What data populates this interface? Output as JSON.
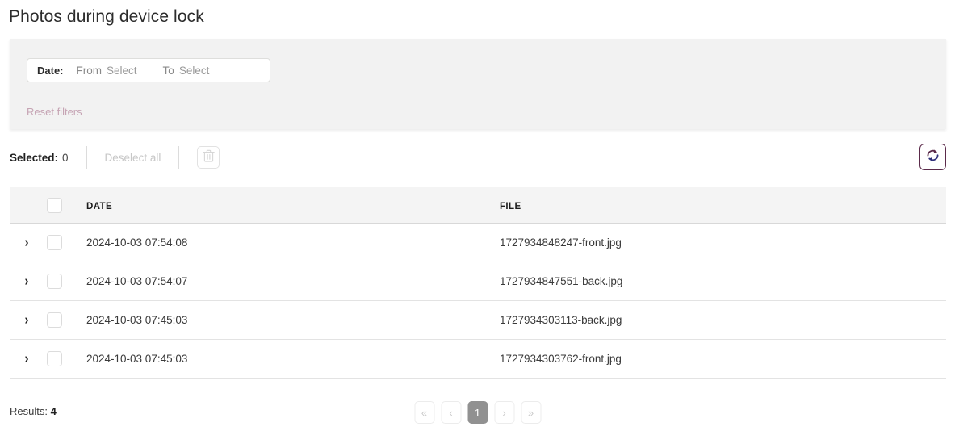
{
  "header": {
    "title": "Photos during device lock"
  },
  "filters": {
    "date": {
      "label": "Date:",
      "from_prefix": "From",
      "from_value": "Select",
      "to_prefix": "To",
      "to_value": "Select"
    },
    "reset_label": "Reset filters"
  },
  "toolbar": {
    "selected_label": "Selected:",
    "selected_count": "0",
    "deselect_all_label": "Deselect all",
    "delete_icon": "trash-icon",
    "refresh_icon": "refresh-icon",
    "accent_color": "#5b2a4a",
    "reset_link_color": "#c6a4b4"
  },
  "table": {
    "columns": [
      "DATE",
      "FILE"
    ],
    "rows": [
      {
        "date": "2024-10-03 07:54:08",
        "file": "1727934848247-front.jpg"
      },
      {
        "date": "2024-10-03 07:54:07",
        "file": "1727934847551-back.jpg"
      },
      {
        "date": "2024-10-03 07:45:03",
        "file": "1727934303113-back.jpg"
      },
      {
        "date": "2024-10-03 07:45:03",
        "file": "1727934303762-front.jpg"
      }
    ],
    "expand_icon": "chevron-right-icon"
  },
  "footer": {
    "results_label": "Results:",
    "results_count": "4",
    "pagination": {
      "first": "«",
      "prev": "‹",
      "current": "1",
      "next": "›",
      "last": "»"
    }
  }
}
